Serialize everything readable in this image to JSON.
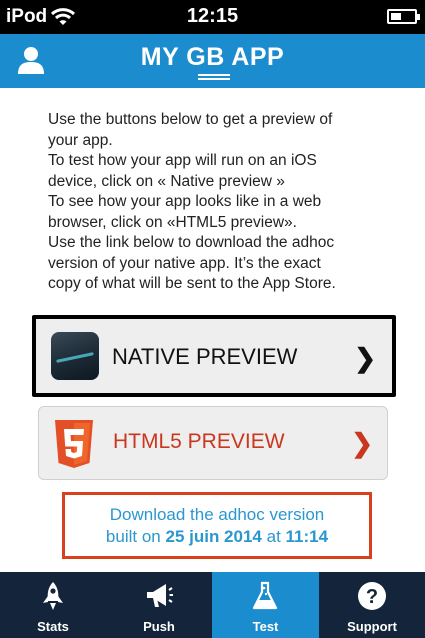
{
  "status_bar": {
    "carrier": "iPod",
    "time": "12:15"
  },
  "header": {
    "title": "MY GB APP"
  },
  "intro": {
    "lines": [
      "Use the buttons below to get a preview of",
      "your app.",
      "To test how your app will run on an iOS",
      "device, click on « Native preview »",
      "To see how your app looks like in a web",
      "browser, click on «HTML5 preview».",
      "Use the link below to download the adhoc",
      "version of your native app. It’s the exact",
      "copy of what will be sent to the App Store."
    ]
  },
  "native_preview": {
    "label": "NATIVE PREVIEW",
    "chevron": "❯"
  },
  "html5_preview": {
    "label": "HTML5 PREVIEW",
    "chevron": "❯",
    "accent": "#c9371f"
  },
  "download": {
    "line1": "Download the adhoc version",
    "prefix": "built on",
    "date": "25 juin 2014",
    "at": "at",
    "time": "11:14",
    "color": "#2b97cf",
    "border_color": "#d8401f"
  },
  "tabs": [
    {
      "label": "Stats",
      "icon": "rocket-icon",
      "active": false
    },
    {
      "label": "Push",
      "icon": "megaphone-icon",
      "active": false
    },
    {
      "label": "Test",
      "icon": "flask-icon",
      "active": true
    },
    {
      "label": "Support",
      "icon": "help-icon",
      "active": false
    }
  ],
  "colors": {
    "brand": "#1b8ccd",
    "tabbar": "#14243a"
  }
}
